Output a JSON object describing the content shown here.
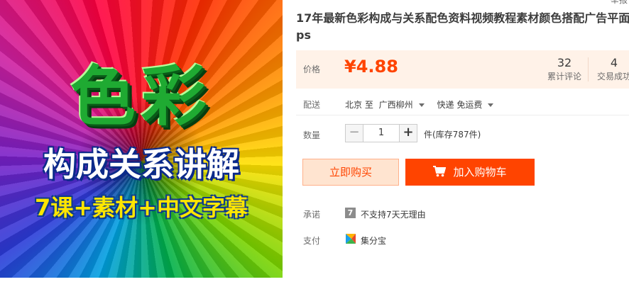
{
  "image": {
    "title": "色彩",
    "subtitle": "构成关系讲解",
    "tagline": "7课+素材+中文字幕"
  },
  "top_cut_text": "举报",
  "product": {
    "title_line1": "17年最新色彩构成与关系配色资料视频教程素材颜色搭配广告平面",
    "title_line2": "ps"
  },
  "price": {
    "label": "价格",
    "value": "¥4.88",
    "reviews_count": "32",
    "reviews_label": "累计评论",
    "trades_count": "4",
    "trades_label": "交易成功"
  },
  "shipping": {
    "label": "配送",
    "from": "北京 至",
    "to": "广西柳州",
    "method": "快递 免运费"
  },
  "quantity": {
    "label": "数量",
    "minus": "−",
    "value": "1",
    "plus": "+",
    "stock": "件(库存787件)"
  },
  "actions": {
    "buy_now": "立即购买",
    "add_to_cart": "加入购物车"
  },
  "promise": {
    "label": "承诺",
    "icon_text": "7",
    "text": "不支持7天无理由"
  },
  "payment": {
    "label": "支付",
    "text": "集分宝"
  },
  "colors": {
    "accent": "#ff4400",
    "price_bg": "#fff2e8"
  }
}
